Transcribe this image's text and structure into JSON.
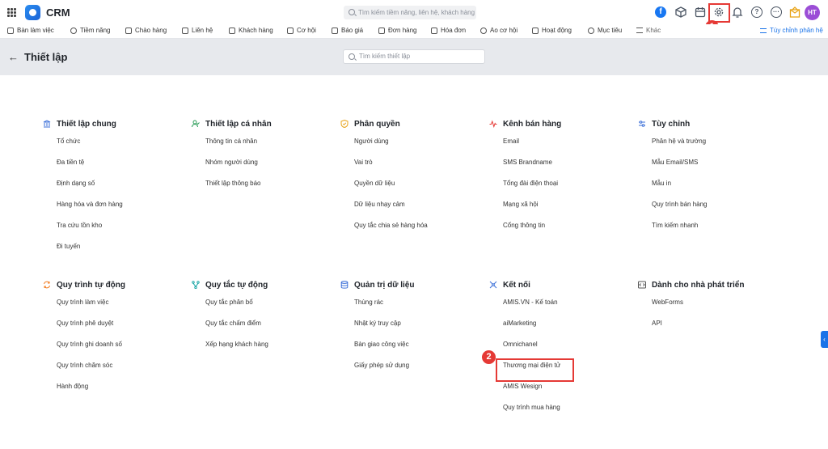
{
  "topbar": {
    "app_name": "CRM",
    "search_placeholder": "Tìm kiếm tiềm năng, liên hệ, khách hàng",
    "avatar_initials": "HT",
    "accent_color": "#1a73e8",
    "callout_1": "1",
    "callout_2": "2"
  },
  "nav": {
    "items": [
      {
        "label": "Bàn làm việc",
        "icon": "home-icon"
      },
      {
        "label": "Tiềm năng",
        "icon": "user-circle-icon"
      },
      {
        "label": "Chào hàng",
        "icon": "magnet-icon"
      },
      {
        "label": "Liên hệ",
        "icon": "contact-card-icon"
      },
      {
        "label": "Khách hàng",
        "icon": "building-icon"
      },
      {
        "label": "Cơ hội",
        "icon": "briefcase-icon"
      },
      {
        "label": "Báo giá",
        "icon": "document-icon"
      },
      {
        "label": "Đơn hàng",
        "icon": "cart-icon"
      },
      {
        "label": "Hóa đơn",
        "icon": "invoice-icon"
      },
      {
        "label": "Ao cơ hội",
        "icon": "bulb-icon"
      },
      {
        "label": "Hoạt động",
        "icon": "activity-icon"
      },
      {
        "label": "Mục tiêu",
        "icon": "target-icon"
      },
      {
        "label": "Khác",
        "icon": "menu-icon"
      }
    ],
    "customize_label": "Tùy chỉnh phân hệ"
  },
  "header": {
    "title": "Thiết lập",
    "search_placeholder": "Tìm kiếm thiết lập"
  },
  "groups": [
    {
      "title": "Thiết lập chung",
      "icon": "bank-icon",
      "items": [
        "Tổ chức",
        "Đa tiền tệ",
        "Định dạng số",
        "Hàng hóa và đơn hàng",
        "Tra cứu tồn kho",
        "Đi tuyến"
      ]
    },
    {
      "title": "Thiết lập cá nhân",
      "icon": "user-check-icon",
      "items": [
        "Thông tin cá nhân",
        "Nhóm người dùng",
        "Thiết lập thông báo"
      ]
    },
    {
      "title": "Phân quyền",
      "icon": "shield-icon",
      "items": [
        "Người dùng",
        "Vai trò",
        "Quyền dữ liệu",
        "Dữ liệu nhạy cảm",
        "Quy tắc chia sẻ hàng hóa"
      ]
    },
    {
      "title": "Kênh bán hàng",
      "icon": "pulse-icon",
      "items": [
        "Email",
        "SMS Brandname",
        "Tổng đài điện thoại",
        "Mạng xã hội",
        "Cổng thông tin"
      ]
    },
    {
      "title": "Tùy chỉnh",
      "icon": "sliders-icon",
      "items": [
        "Phân hệ và trường",
        "Mẫu Email/SMS",
        "Mẫu in",
        "Quy trình bán hàng",
        "Tìm kiếm nhanh"
      ]
    },
    {
      "title": "Quy trình tự động",
      "icon": "sync-icon",
      "items": [
        "Quy trình làm việc",
        "Quy trình phê duyệt",
        "Quy trình ghi doanh số",
        "Quy trình chăm sóc",
        "Hành động"
      ]
    },
    {
      "title": "Quy tắc tự động",
      "icon": "branch-icon",
      "items": [
        "Quy tắc phân bổ",
        "Quy tắc chấm điểm",
        "Xếp hạng khách hàng"
      ]
    },
    {
      "title": "Quản trị dữ liệu",
      "icon": "database-icon",
      "items": [
        "Thùng rác",
        "Nhật ký truy cập",
        "Bàn giao công việc",
        "Giấy phép sử dụng"
      ]
    },
    {
      "title": "Kết nối",
      "icon": "network-icon",
      "items": [
        "AMIS.VN - Kế toán",
        "aiMarketing",
        "Omnichanel",
        "Thương mại điện tử",
        "AMIS Wesign",
        "Quy trình mua hàng"
      ]
    },
    {
      "title": "Dành cho nhà phát triển",
      "icon": "code-icon",
      "items": [
        "WebForms",
        "API"
      ]
    }
  ]
}
